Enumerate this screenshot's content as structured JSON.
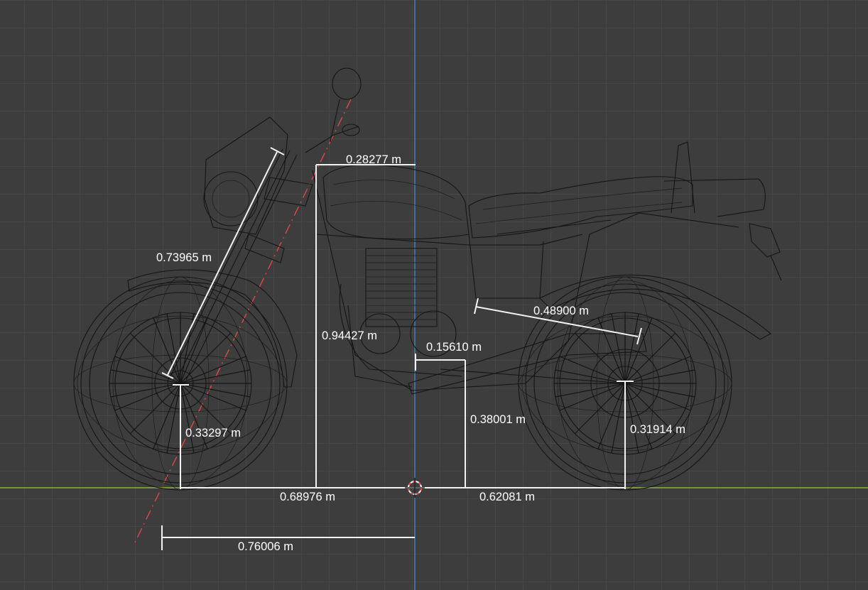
{
  "viewport": {
    "view": "3D viewport – side orthographic wireframe",
    "object": "motorcycle wireframe model",
    "colors": {
      "background": "#3d3d3d",
      "grid": "#4a4a4a",
      "x_axis": "#8bb13a",
      "z_axis": "#3f7fb8",
      "steering_axis": "#e04848",
      "wireframe": "#151515",
      "measure": "#f2f2f2"
    }
  },
  "measurements": [
    {
      "id": "fork-length",
      "label": "0.73965 m"
    },
    {
      "id": "top-width",
      "label": "0.28277 m"
    },
    {
      "id": "front-height",
      "label": "0.94427 m"
    },
    {
      "id": "seat-slope",
      "label": "0.48900 m"
    },
    {
      "id": "engine-offset",
      "label": "0.15610 m"
    },
    {
      "id": "engine-height",
      "label": "0.38001 m"
    },
    {
      "id": "front-axle-height",
      "label": "0.33297 m"
    },
    {
      "id": "rear-axle-height",
      "label": "0.31914 m"
    },
    {
      "id": "front-distance",
      "label": "0.68976 m"
    },
    {
      "id": "rear-distance",
      "label": "0.62081 m"
    },
    {
      "id": "trail-distance",
      "label": "0.76006 m"
    }
  ],
  "icons": {
    "cursor": "3d-cursor-icon"
  }
}
